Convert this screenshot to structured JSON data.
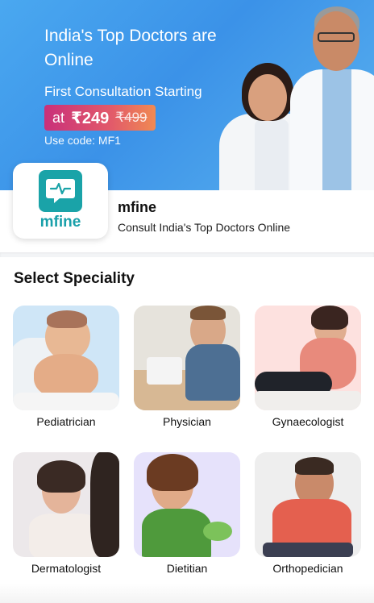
{
  "banner": {
    "headline": "India's Top Doctors are Online",
    "subline": "First Consultation Starting",
    "price_prefix": "at",
    "price": "₹249",
    "old_price": "₹499",
    "code_text": "Use code: MF1"
  },
  "app": {
    "logo_text": "mfine",
    "name": "mfine",
    "tagline": "Consult India's Top Doctors Online"
  },
  "section": {
    "title": "Select Speciality"
  },
  "specialities": [
    {
      "label": "Pediatrician",
      "bg": "#cfe6f7"
    },
    {
      "label": "Physician",
      "bg": "#e6e3dc"
    },
    {
      "label": "Gynaecologist",
      "bg": "#fde1df"
    },
    {
      "label": "Dermatologist",
      "bg": "#ece8ea"
    },
    {
      "label": "Dietitian",
      "bg": "#e6e2fb"
    },
    {
      "label": "Orthopedician",
      "bg": "#eeeeee"
    }
  ],
  "colors": {
    "brand": "#1aa3a8",
    "banner_blue": "#3b92e8",
    "price_gradient_start": "#c9307a",
    "price_gradient_end": "#f08a52"
  }
}
